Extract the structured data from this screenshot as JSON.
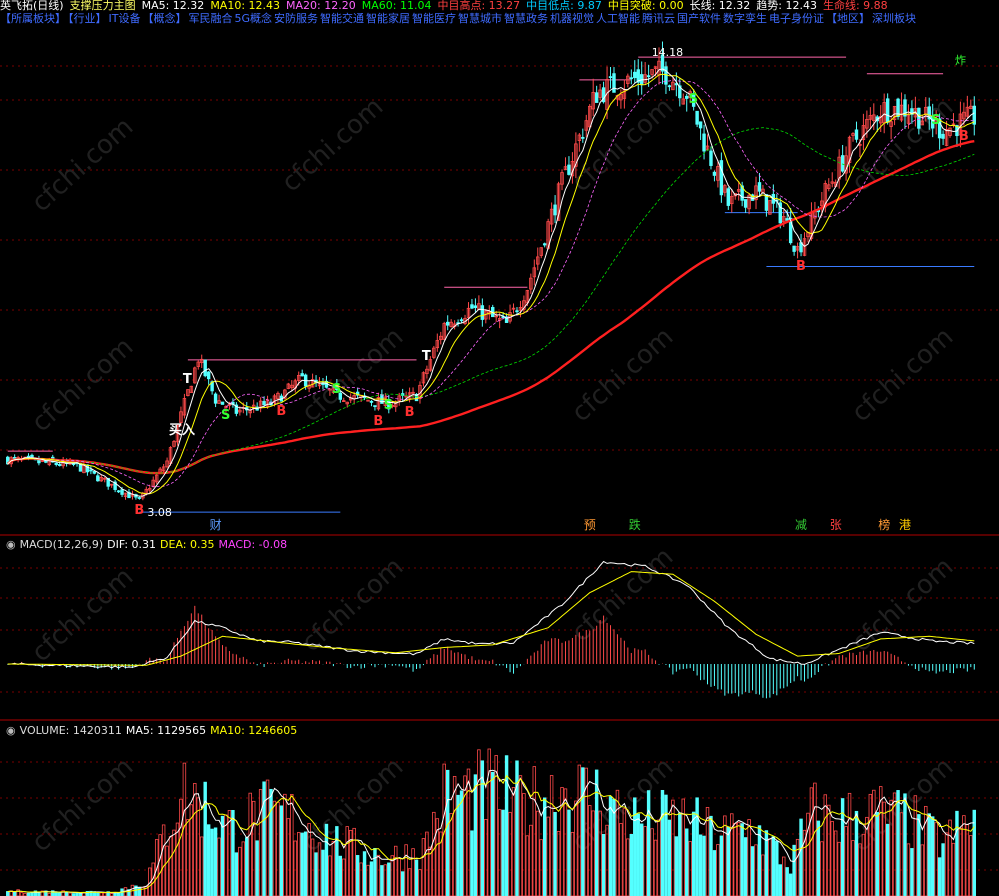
{
  "header": {
    "items": [
      {
        "text": "英飞拓(日线)",
        "color": "#ffffff"
      },
      {
        "text": "支撑压力主图",
        "color": "#ffff66"
      },
      {
        "text": "MA5: 12.32",
        "color": "#ffffff"
      },
      {
        "text": "MA10: 12.43",
        "color": "#ffff00"
      },
      {
        "text": "MA20: 12.20",
        "color": "#ff66ff"
      },
      {
        "text": "MA60: 11.04",
        "color": "#00ff00"
      },
      {
        "text": "中目高点: 13.27",
        "color": "#ff4040"
      },
      {
        "text": "中目低点: 9.87",
        "color": "#00ccff"
      },
      {
        "text": "中目突破: 0.00",
        "color": "#ffff00"
      },
      {
        "text": "长线: 12.32",
        "color": "#ffffff"
      },
      {
        "text": "趋势: 12.43",
        "color": "#ffffff"
      },
      {
        "text": "生命线: 9.88",
        "color": "#ff4040"
      }
    ],
    "tags": [
      "【所属板块】",
      "【行业】",
      "IT设备",
      "【概念】",
      "军民融合",
      "5G概念",
      "安防服务",
      "智能交通",
      "智能家居",
      "智能医疗",
      "智慧城市",
      "智慧政务",
      "机器视觉",
      "人工智能",
      "腾讯云",
      "国产软件",
      "数字孪生",
      "电子身份证",
      "【地区】",
      "深圳板块"
    ]
  },
  "price_panel": {
    "high_label": "14.18",
    "low_label": "3.08",
    "right_marker": "炸",
    "events": [
      {
        "text": "财",
        "color": "#5b9bff",
        "i": 60
      },
      {
        "text": "预",
        "color": "#ff9933",
        "i": 168
      },
      {
        "text": "跌",
        "color": "#33cc33",
        "i": 181
      },
      {
        "text": "减",
        "color": "#33cc33",
        "i": 229
      },
      {
        "text": "张",
        "color": "#ff4040",
        "i": 239
      },
      {
        "text": "榜",
        "color": "#ff9933",
        "i": 253
      },
      {
        "text": "港",
        "color": "#ffcc00",
        "i": 259
      }
    ],
    "signals": [
      {
        "t": "B",
        "i": 38,
        "color": "#ff3030"
      },
      {
        "t": "B",
        "i": 79,
        "color": "#ff3030"
      },
      {
        "t": "B",
        "i": 107,
        "color": "#ff3030"
      },
      {
        "t": "B",
        "i": 116,
        "color": "#ff3030"
      },
      {
        "t": "B",
        "i": 229,
        "color": "#ff3030"
      },
      {
        "t": "B",
        "i": 276,
        "color": "#ff3030"
      },
      {
        "t": "S",
        "i": 63,
        "color": "#33ff33"
      },
      {
        "t": "S",
        "i": 95,
        "color": "#33ff33"
      },
      {
        "t": "S",
        "i": 110,
        "color": "#33ff33"
      },
      {
        "t": "S",
        "i": 198,
        "color": "#33ff33"
      },
      {
        "t": "S",
        "i": 268,
        "color": "#33ff33"
      },
      {
        "t": "买入",
        "i": 48,
        "color": "#ffffff"
      },
      {
        "t": "T",
        "i": 52,
        "color": "#ffffff"
      },
      {
        "t": "T",
        "i": 121,
        "color": "#ffffff"
      }
    ]
  },
  "macd_panel": {
    "title": "MACD(12,26,9)",
    "dif_label": "DIF: 0.31",
    "dea_label": "DEA: 0.35",
    "macd_label": "MACD: -0.08"
  },
  "volume_panel": {
    "title": "VOLUME: 1420311",
    "ma5_label": "MA5: 1129565",
    "ma10_label": "MA10: 1246605"
  },
  "chart_data": {
    "type": "candlestick",
    "title": "英飞拓(日线)",
    "n_bars": 280,
    "x_index": [
      0,
      279
    ],
    "price_range": [
      2.6,
      14.8
    ],
    "price_high": 14.18,
    "price_low": 3.08,
    "ma_current": {
      "MA5": 12.32,
      "MA10": 12.43,
      "MA20": 12.2,
      "MA60": 11.04
    },
    "macd_current": {
      "DIF": 0.31,
      "DEA": 0.35,
      "MACD": -0.08
    },
    "volume_current": {
      "VOLUME": 1420311,
      "MA5": 1129565,
      "MA10": 1246605
    },
    "volume_max": 2000000,
    "price_anchors": [
      [
        0,
        4.35
      ],
      [
        20,
        4.2
      ],
      [
        38,
        3.35
      ],
      [
        46,
        4.3
      ],
      [
        55,
        6.8
      ],
      [
        60,
        5.8
      ],
      [
        66,
        5.5
      ],
      [
        76,
        5.7
      ],
      [
        85,
        6.3
      ],
      [
        95,
        5.9
      ],
      [
        110,
        5.7
      ],
      [
        118,
        5.9
      ],
      [
        126,
        7.6
      ],
      [
        134,
        8.0
      ],
      [
        144,
        7.6
      ],
      [
        150,
        8.5
      ],
      [
        160,
        11.0
      ],
      [
        170,
        13.2
      ],
      [
        180,
        13.5
      ],
      [
        190,
        13.7
      ],
      [
        196,
        13.2
      ],
      [
        202,
        11.8
      ],
      [
        208,
        10.5
      ],
      [
        216,
        10.8
      ],
      [
        224,
        10.2
      ],
      [
        228,
        9.4
      ],
      [
        236,
        10.8
      ],
      [
        244,
        12.0
      ],
      [
        252,
        12.8
      ],
      [
        260,
        12.8
      ],
      [
        270,
        12.3
      ],
      [
        279,
        12.6
      ]
    ],
    "volume_anchors": [
      [
        0,
        60000
      ],
      [
        30,
        50000
      ],
      [
        40,
        180000
      ],
      [
        50,
        1400000
      ],
      [
        56,
        1200000
      ],
      [
        64,
        900000
      ],
      [
        75,
        1100000
      ],
      [
        85,
        1000000
      ],
      [
        95,
        700000
      ],
      [
        110,
        500000
      ],
      [
        120,
        600000
      ],
      [
        126,
        1300000
      ],
      [
        140,
        1400000
      ],
      [
        150,
        1200000
      ],
      [
        160,
        1400000
      ],
      [
        170,
        1300000
      ],
      [
        180,
        1000000
      ],
      [
        195,
        1000000
      ],
      [
        205,
        800000
      ],
      [
        215,
        900000
      ],
      [
        226,
        400000
      ],
      [
        232,
        1100000
      ],
      [
        240,
        1000000
      ],
      [
        250,
        1100000
      ],
      [
        260,
        1000000
      ],
      [
        270,
        700000
      ],
      [
        279,
        1000000
      ]
    ],
    "dif_anchors": [
      [
        0,
        0.0
      ],
      [
        36,
        -0.05
      ],
      [
        46,
        0.1
      ],
      [
        54,
        0.65
      ],
      [
        62,
        0.55
      ],
      [
        72,
        0.35
      ],
      [
        82,
        0.33
      ],
      [
        100,
        0.2
      ],
      [
        118,
        0.15
      ],
      [
        126,
        0.38
      ],
      [
        136,
        0.3
      ],
      [
        146,
        0.32
      ],
      [
        160,
        0.9
      ],
      [
        172,
        1.55
      ],
      [
        184,
        1.48
      ],
      [
        196,
        1.2
      ],
      [
        208,
        0.55
      ],
      [
        220,
        0.08
      ],
      [
        230,
        0.0
      ],
      [
        240,
        0.22
      ],
      [
        252,
        0.48
      ],
      [
        266,
        0.35
      ],
      [
        279,
        0.31
      ]
    ],
    "dea_anchors": [
      [
        0,
        0.0
      ],
      [
        40,
        -0.02
      ],
      [
        50,
        0.12
      ],
      [
        62,
        0.42
      ],
      [
        76,
        0.34
      ],
      [
        92,
        0.25
      ],
      [
        112,
        0.17
      ],
      [
        126,
        0.25
      ],
      [
        140,
        0.29
      ],
      [
        156,
        0.55
      ],
      [
        168,
        1.08
      ],
      [
        180,
        1.4
      ],
      [
        192,
        1.36
      ],
      [
        204,
        0.95
      ],
      [
        216,
        0.45
      ],
      [
        228,
        0.12
      ],
      [
        240,
        0.16
      ],
      [
        252,
        0.38
      ],
      [
        266,
        0.42
      ],
      [
        279,
        0.35
      ]
    ],
    "support_lines": [
      {
        "price": 3.08,
        "from": 38,
        "to": 96,
        "color": "#3a7bff"
      },
      {
        "price": 9.0,
        "from": 219,
        "to": 279,
        "color": "#3a7bff"
      },
      {
        "price": 10.3,
        "from": 207,
        "to": 228,
        "color": "#3a7bff"
      },
      {
        "price": 6.75,
        "from": 52,
        "to": 118,
        "color": "#ff66aa"
      },
      {
        "price": 8.5,
        "from": 126,
        "to": 150,
        "color": "#ff66aa"
      },
      {
        "price": 13.5,
        "from": 165,
        "to": 180,
        "color": "#ff66aa"
      },
      {
        "price": 14.05,
        "from": 182,
        "to": 242,
        "color": "#ff66aa"
      },
      {
        "price": 13.65,
        "from": 248,
        "to": 270,
        "color": "#ff66aa"
      },
      {
        "price": 4.55,
        "from": 0,
        "to": 13,
        "color": "#ff66aa"
      }
    ]
  },
  "colors": {
    "up": "#ff4a4a",
    "down": "#54ffff",
    "ma5": "#ffffff",
    "ma10": "#ffff00",
    "ma20": "#ff66ff",
    "ma60": "#00dd00",
    "life": "#ff2020",
    "grid": "#7a0000"
  }
}
